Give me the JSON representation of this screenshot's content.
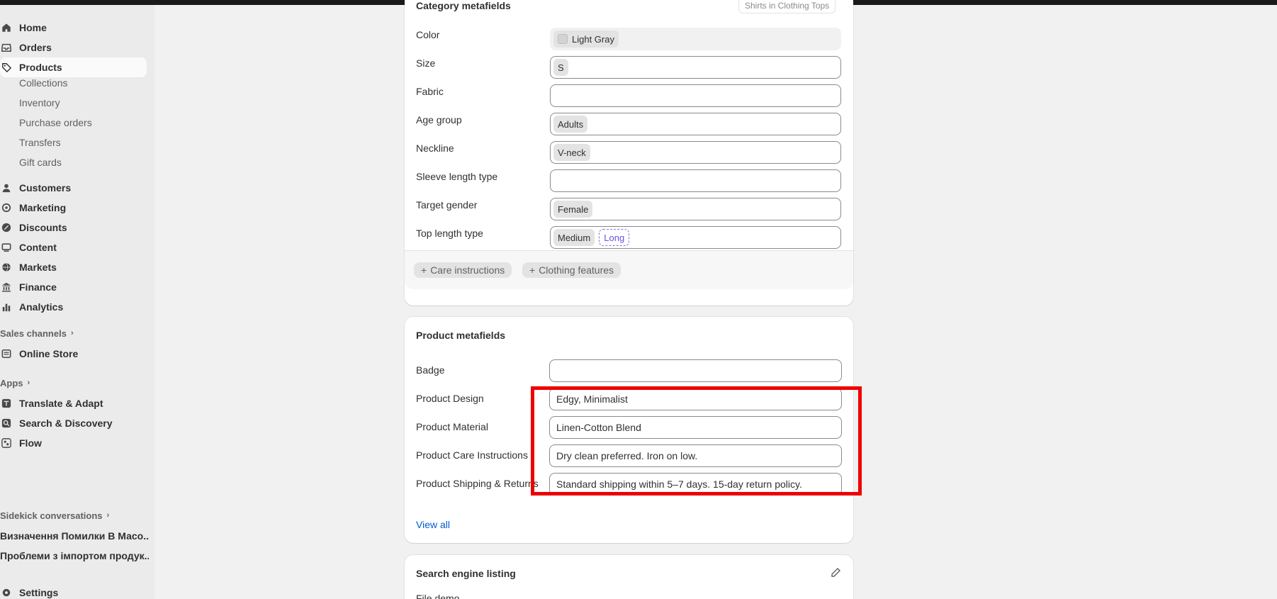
{
  "sidebar": {
    "nav": [
      {
        "label": "Home",
        "icon": "home-icon"
      },
      {
        "label": "Orders",
        "icon": "inbox-icon"
      },
      {
        "label": "Products",
        "icon": "tag-icon",
        "active": true
      }
    ],
    "product_sub": [
      "Collections",
      "Inventory",
      "Purchase orders",
      "Transfers",
      "Gift cards"
    ],
    "nav2": [
      {
        "label": "Customers",
        "icon": "person-icon"
      },
      {
        "label": "Marketing",
        "icon": "target-icon"
      },
      {
        "label": "Discounts",
        "icon": "discount-icon"
      },
      {
        "label": "Content",
        "icon": "content-icon"
      },
      {
        "label": "Markets",
        "icon": "globe-icon"
      },
      {
        "label": "Finance",
        "icon": "bank-icon"
      },
      {
        "label": "Analytics",
        "icon": "bar-chart-icon"
      }
    ],
    "sales_channels_label": "Sales channels",
    "online_store": "Online Store",
    "apps_label": "Apps",
    "apps": [
      "Translate & Adapt",
      "Search & Discovery",
      "Flow"
    ],
    "sidekick_label": "Sidekick conversations",
    "conversations": [
      "Визначення Помилки В Масо...",
      "Проблеми з імпортом продук..."
    ],
    "settings": "Settings"
  },
  "category_card": {
    "partial_title": "Category metafields",
    "partial_badge": "Shirts in Clothing Tops",
    "rows": [
      {
        "label": "Color",
        "chips": [
          "Light Gray"
        ],
        "filled": true,
        "swatch": true
      },
      {
        "label": "Size",
        "chips": [
          "S"
        ]
      },
      {
        "label": "Fabric",
        "chips": []
      },
      {
        "label": "Age group",
        "chips": [
          "Adults"
        ]
      },
      {
        "label": "Neckline",
        "chips": [
          "V-neck"
        ]
      },
      {
        "label": "Sleeve length type",
        "chips": []
      },
      {
        "label": "Target gender",
        "chips": [
          "Female"
        ]
      },
      {
        "label": "Top length type",
        "chips": [
          "Medium"
        ],
        "suggested": "Long"
      }
    ],
    "footer_buttons": [
      "Care instructions",
      "Clothing features"
    ]
  },
  "product_metafields": {
    "title": "Product metafields",
    "rows": [
      {
        "label": "Badge",
        "value": ""
      },
      {
        "label": "Product Design",
        "value": "Edgy, Minimalist"
      },
      {
        "label": "Product Material",
        "value": "Linen-Cotton Blend"
      },
      {
        "label": "Product Care Instructions",
        "value": "Dry clean preferred. Iron on low."
      },
      {
        "label": "Product Shipping & Returns",
        "value": "Standard shipping within 5–7 days. 15-day return policy."
      }
    ],
    "view_all": "View all"
  },
  "seo_card": {
    "title": "Search engine listing",
    "partial_row": "File demo"
  },
  "colors": {
    "highlight": "#ee0000",
    "link": "#005bd3",
    "suggested_chip": "#6d4fe0"
  }
}
